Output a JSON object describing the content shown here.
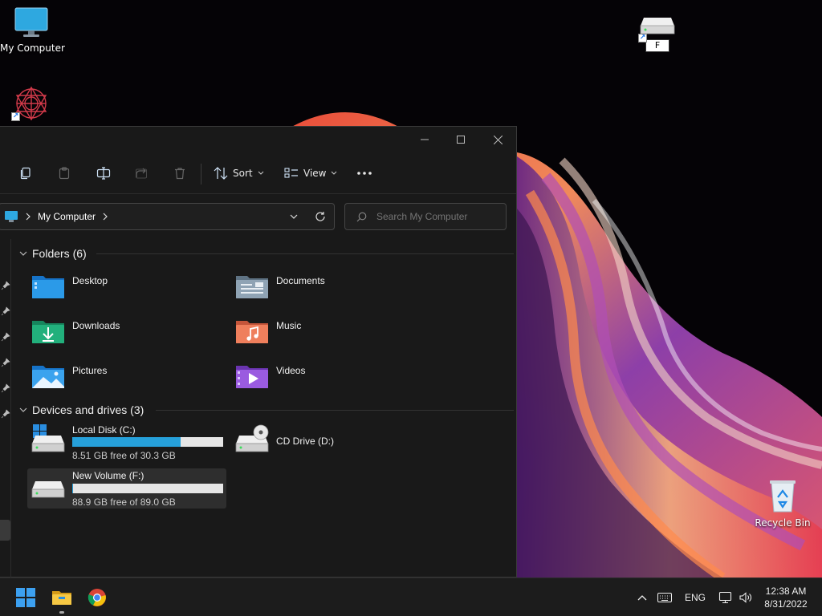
{
  "desktop": {
    "icons": [
      {
        "label": "My Computer"
      },
      {
        "label": ""
      },
      {
        "label": "F"
      },
      {
        "label": "Recycle Bin"
      }
    ]
  },
  "window": {
    "toolbar": {
      "sort_label": "Sort",
      "view_label": "View"
    },
    "address": {
      "location": "My Computer"
    },
    "search": {
      "placeholder": "Search My Computer"
    },
    "folders_header": "Folders (6)",
    "folders": [
      {
        "name": "Desktop",
        "icon": "desktop-folder-icon"
      },
      {
        "name": "Documents",
        "icon": "documents-folder-icon"
      },
      {
        "name": "Downloads",
        "icon": "downloads-folder-icon"
      },
      {
        "name": "Music",
        "icon": "music-folder-icon"
      },
      {
        "name": "Pictures",
        "icon": "pictures-folder-icon"
      },
      {
        "name": "Videos",
        "icon": "videos-folder-icon"
      }
    ],
    "drives_header": "Devices and drives (3)",
    "drives": [
      {
        "name": "Local Disk (C:)",
        "free_text": "8.51 GB free of 30.3 GB",
        "used_fraction": 0.72
      },
      {
        "name": "CD Drive (D:)"
      },
      {
        "name": "New Volume (F:)",
        "free_text": "88.9 GB free of 89.0 GB",
        "used_fraction": 0.001
      }
    ]
  },
  "taskbar": {
    "language": "ENG",
    "time": "12:38 AM",
    "date": "8/31/2022"
  },
  "colors": {
    "accent": "#26a0da",
    "window_bg": "#191919",
    "taskbar_bg": "#1c1c1c"
  }
}
